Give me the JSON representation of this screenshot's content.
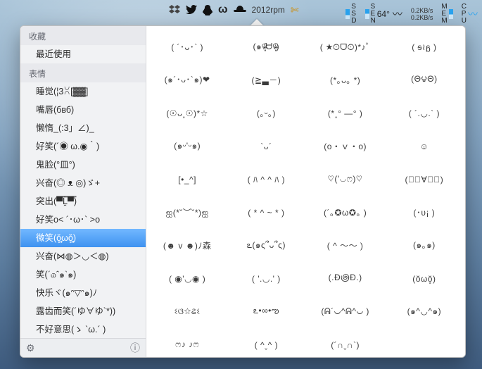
{
  "menubar": {
    "dropbox_label": "Dropbox",
    "rpm": "2012rpm",
    "ssd_label": "SSD",
    "sen_temp": "64°",
    "net_up": "0.2KB/s",
    "net_dn": "0.2KB/s",
    "mem_label": "MEM",
    "cpu_label": "CPU"
  },
  "sidebar": {
    "sections": [
      {
        "header": "收藏",
        "items": [
          "最近使用"
        ]
      },
      {
        "header": "表情",
        "items": [
          "睡觉(¦3ꇤ[▓▓]",
          "嘴唇(бвб)",
          "懒惰_(:3」∠)_",
          "好笑(´◉ ω.◉｀)",
          "鬼脸(°皿°)",
          "兴奋(◎ ᴥ ◎)ゞ+",
          "突出(▀̿̿Ĺ̯̿̿▀̿)",
          "好笑o< ´･ω･` >o",
          "微笑(ŏ̥̥̥̥ωŏ̥̥̥̥)",
          "兴奋(⋈◍＞◡＜◍)",
          "笑(ˊ௰ˆ๑ˋ๑)",
          "快乐ヾ(๑ᵔ▽ᵔ๑)ﾉ",
          "露齿而笑(´ゆ∀ゆ`*))",
          "不好意思(ゝ `ω.´ )"
        ],
        "selected_index": 8
      }
    ],
    "gear": "⚙",
    "info": "ⓘ"
  },
  "grid": [
    "( ´･ᴗ･` )",
    "(๑ᵒ̴̶̷͈᷄ᗨᵒ̴̶̷͈᷅)",
    "( ★☉ᗜ☉)*♪ﾟ",
    "( ᵴ≀ᵷ )",
    "(๑´･ᴗ･`๑)❤",
    "(≧▃－)",
    "(*｡ᴗ｡ *)",
    "(Θ౪Θ)",
    "(☉ᴗ˳☉)*☆",
    "(｡ᵕ｡)",
    "(*˳° —°  )",
    "( ´.◡.` )",
    "(๑ᵕ'ᵕ๑)",
    "`ᴗ´",
    "(o・ｖ・o)",
    "☺",
    "[•_^]",
    "( ﾊ ^ ^ ﾊ )",
    "♡('◡ෆ)♡",
    "(◎ฺ∀◎ฺ)",
    "ஐ(*˘︶˘*)ஐ",
    "( * ^ ~ * )",
    "(´｡✪ω✪｡ )",
    "(･υ¡  )",
    "(☻ v ☻)ﾉ森",
    "ఽ(๑ς՞ᴗ՞ς)",
    "( ^ 〜〜 )",
    "(๑｡๑)",
    "( ◉'◡◉ )",
    "( '.◡.' )",
    "(.Ð಄Ð.)",
    "(ŏωŏ̥)",
    "ଽଓ☆ଌଽ",
    "ఽ•∞•ఌ",
    "(ᕱ´◡^ᕱ^◡ )",
    "(๑^◡^๑)",
    "ෆ♪  ♪ෆ",
    "( ^ˬ^ )",
    "(´∩ˬ∩`)"
  ]
}
